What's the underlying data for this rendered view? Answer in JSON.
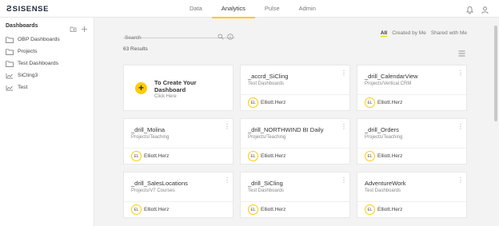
{
  "brand": {
    "mark": "Ƨ",
    "name": "SISENSE"
  },
  "nav": [
    "Data",
    "Analytics",
    "Pulse",
    "Admin"
  ],
  "nav_active": "Analytics",
  "icons": {
    "bell": "bell-icon",
    "user": "user-icon"
  },
  "sidebar": {
    "title": "Dashboards",
    "items": [
      {
        "label": "OBP Dashboards",
        "icon": "folder-icon"
      },
      {
        "label": "Projects",
        "icon": "folder-icon"
      },
      {
        "label": "Test Dashboards",
        "icon": "folder-icon"
      },
      {
        "label": "SiCling3",
        "icon": "dashboard-icon"
      },
      {
        "label": "Test",
        "icon": "dashboard-icon"
      }
    ]
  },
  "search": {
    "placeholder": "Search"
  },
  "filters": {
    "all": "All",
    "created": "Created by Me",
    "shared": "Shared with Me"
  },
  "results": "63 Results",
  "create_card": {
    "title": "To Create Your Dashboard",
    "sub": "Click Here"
  },
  "cards": [
    {
      "title": "_accrd_SiCling",
      "sub": "Test Dashboards",
      "initials": "EL",
      "owner": "Elliott.Herz"
    },
    {
      "title": "_drill_CalendarView",
      "sub": "Projects/Vertical CRM",
      "initials": "EL",
      "owner": "Elliott.Herz"
    },
    {
      "title": "_drill_Molina",
      "sub": "Projects/Teaching",
      "initials": "EL",
      "owner": "Elliott.Herz"
    },
    {
      "title": "_drill_NORTHWIND BI Daily",
      "sub": "Projects/Teaching",
      "initials": "EL",
      "owner": "Elliott.Herz"
    },
    {
      "title": "_drill_Orders",
      "sub": "Projects/Teaching",
      "initials": "EL",
      "owner": "Elliott.Herz"
    },
    {
      "title": "_drill_SalesLocations",
      "sub": "Projects/V7 Courses",
      "initials": "EL",
      "owner": "Elliott.Herz"
    },
    {
      "title": "_drill_SiCling",
      "sub": "Test Dashboards",
      "initials": "EL",
      "owner": "Elliott.Herz"
    },
    {
      "title": "AdventureWork",
      "sub": "Test Dashboards",
      "initials": "EL",
      "owner": "Elliott.Herz"
    }
  ],
  "colors": {
    "accent": "#ffcb05",
    "brand": "#1f2b3d"
  }
}
